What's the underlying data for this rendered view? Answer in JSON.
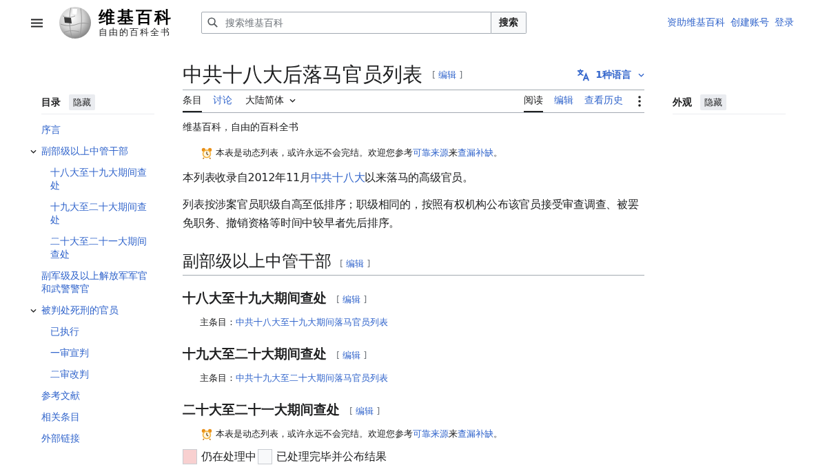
{
  "header": {
    "title": "维基百科",
    "tagline": "自由的百科全书",
    "search": {
      "placeholder": "搜索维基百科",
      "button": "搜索"
    },
    "user_links": [
      "资助维基百科",
      "创建账号",
      "登录"
    ]
  },
  "toc": {
    "title": "目录",
    "hide_button": "隐藏",
    "items": [
      {
        "label": "序言"
      },
      {
        "label": "副部级以上中管干部",
        "expanded": true,
        "children": [
          {
            "label": "十八大至十九大期间查处"
          },
          {
            "label": "十九大至二十大期间查处"
          },
          {
            "label": "二十大至二十一大期间查处"
          }
        ]
      },
      {
        "label": "副军级及以上解放军军官和武警警官"
      },
      {
        "label": "被判处死刑的官员",
        "expanded": true,
        "children": [
          {
            "label": "已执行"
          },
          {
            "label": "一审宣判"
          },
          {
            "label": "二审改判"
          }
        ]
      },
      {
        "label": "参考文献"
      },
      {
        "label": "相关条目"
      },
      {
        "label": "外部链接"
      }
    ]
  },
  "article": {
    "title": "中共十八大后落马官员列表",
    "title_edit": "[ 编辑 ]",
    "languages": "1种语言",
    "tabs_left": [
      {
        "label": "条目",
        "selected": true
      },
      {
        "label": "讨论",
        "selected": false
      }
    ],
    "variant": "大陆简体",
    "tabs_right": [
      {
        "label": "阅读",
        "selected": true
      },
      {
        "label": "编辑",
        "selected": false
      },
      {
        "label": "查看历史",
        "selected": false
      }
    ],
    "site_tagline": "维基百科，自由的百科全书",
    "blocks": [
      {
        "kind": "notice",
        "segments": [
          {
            "kind": "text",
            "text": "本表是动态列表，或许永远不会完结。欢迎您参考"
          },
          {
            "kind": "link",
            "text": "可靠来源"
          },
          {
            "kind": "text",
            "text": "来"
          },
          {
            "kind": "link",
            "text": "查漏补缺"
          },
          {
            "kind": "text",
            "text": "。"
          }
        ]
      },
      {
        "kind": "paragraph",
        "segments": [
          {
            "kind": "text",
            "text": "本列表收录自2012年11月"
          },
          {
            "kind": "link",
            "text": "中共十八大"
          },
          {
            "kind": "text",
            "text": "以来落马的高级官员。"
          }
        ]
      },
      {
        "kind": "paragraph",
        "segments": [
          {
            "kind": "text",
            "text": "列表按涉案官员职级自高至低排序；职级相同的，按照有权机构公布该官员接受审查调查、被罢免职务、撤销资格等时间中较早者先后排序。"
          }
        ]
      },
      {
        "kind": "h2",
        "text": "副部级以上中管干部",
        "edit": "[ 编辑 ]"
      },
      {
        "kind": "h3",
        "text": "十八大至十九大期间查处",
        "edit": "[ 编辑 ]"
      },
      {
        "kind": "hatnote",
        "segments": [
          {
            "kind": "text",
            "text": "主条目："
          },
          {
            "kind": "link",
            "text": "中共十八大至十九大期间落马官员列表"
          }
        ]
      },
      {
        "kind": "h3",
        "text": "十九大至二十大期间查处",
        "edit": "[ 编辑 ]"
      },
      {
        "kind": "hatnote",
        "segments": [
          {
            "kind": "text",
            "text": "主条目："
          },
          {
            "kind": "link",
            "text": "中共十九大至二十大期间落马官员列表"
          }
        ]
      },
      {
        "kind": "h3",
        "text": "二十大至二十一大期间查处",
        "edit": "[ 编辑 ]"
      },
      {
        "kind": "notice",
        "segments": [
          {
            "kind": "text",
            "text": "本表是动态列表，或许永远不会完结。欢迎您参考"
          },
          {
            "kind": "link",
            "text": "可靠来源"
          },
          {
            "kind": "text",
            "text": "来"
          },
          {
            "kind": "link",
            "text": "查漏补缺"
          },
          {
            "kind": "text",
            "text": "。"
          }
        ]
      },
      {
        "kind": "legend",
        "items": [
          {
            "label": "仍在处理中",
            "color": "#f8d0d0"
          },
          {
            "label": "已处理完毕并公布结果",
            "color": "#f8f9fa"
          }
        ]
      }
    ]
  },
  "appearance": {
    "title": "外观",
    "hide_button": "隐藏"
  }
}
